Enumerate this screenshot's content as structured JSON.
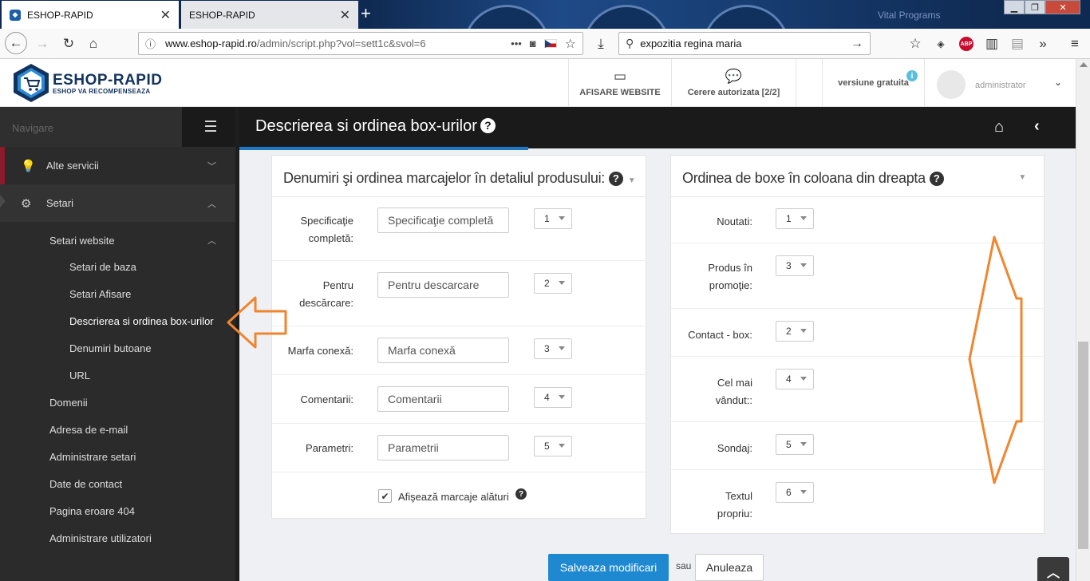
{
  "browser": {
    "tabs": [
      {
        "title": "ESHOP-RAPID",
        "active": true
      },
      {
        "title": "ESHOP-RAPID",
        "active": false
      }
    ],
    "url_domain": "www.eshop-rapid.ro",
    "url_path": "/admin/script.php?vol=sett1c&svol=6",
    "search_value": "expozitia regina maria",
    "bg_text": "Vital Programs",
    "menu_dots": "•••"
  },
  "header": {
    "logo_title": "ESHOP-RAPID",
    "logo_subtitle": "ESHOP VA RECOMPENSEAZA",
    "afisare_label": "AFISARE WEBSITE",
    "cerere_label": "Cerere autorizata [2/2]",
    "versiune_label": "versiune gratuita",
    "info_badge": "i",
    "user_name": "administrator"
  },
  "sidebar": {
    "nav_label": "Navigare",
    "alte_servicii": "Alte servicii",
    "setari": "Setari",
    "setari_website": "Setari website",
    "sub_items": [
      "Setari de baza",
      "Setari Afisare",
      "Descrierea si ordinea box-urilor",
      "Denumiri butoane",
      "URL"
    ],
    "items": [
      "Domenii",
      "Adresa de e-mail",
      "Administrare setari",
      "Date de contact",
      "Pagina eroare 404",
      "Administrare utilizatori"
    ]
  },
  "page": {
    "title": "Descrierea si ordinea box-urilor"
  },
  "left_panel": {
    "title": "Denumiri şi ordinea marcajelor în detaliul produsului:",
    "rows": [
      {
        "label_1": "Specificaţie",
        "label_2": "completă:",
        "value": "Specificaţie completă",
        "order": "1"
      },
      {
        "label_1": "Pentru",
        "label_2": "descărcare:",
        "value": "Pentru descarcare",
        "order": "2"
      },
      {
        "label_1": "Marfa conexă:",
        "label_2": "",
        "value": "Marfa conexă",
        "order": "3"
      },
      {
        "label_1": "Comentarii:",
        "label_2": "",
        "value": "Comentarii",
        "order": "4"
      },
      {
        "label_1": "Parametri:",
        "label_2": "",
        "value": "Parametrii",
        "order": "5"
      }
    ],
    "checkbox_label": "Afişează marcaje alături"
  },
  "right_panel": {
    "title": "Ordinea de boxe în coloana din dreapta",
    "rows": [
      {
        "label_1": "Noutati:",
        "label_2": "",
        "order": "1"
      },
      {
        "label_1": "Produs în",
        "label_2": "promoţie:",
        "order": "3"
      },
      {
        "label_1": "Contact - box:",
        "label_2": "",
        "order": "2"
      },
      {
        "label_1": "Cel mai",
        "label_2": "vândut::",
        "order": "4"
      },
      {
        "label_1": "Sondaj:",
        "label_2": "",
        "order": "5"
      },
      {
        "label_1": "Textul",
        "label_2": "propriu:",
        "order": "6"
      }
    ]
  },
  "actions": {
    "save": "Salveaza modificari",
    "or": "sau",
    "cancel": "Anuleaza"
  },
  "colors": {
    "accent": "#1e88d0",
    "annotation_arrow": "#f0852e",
    "sidebar_bg": "#2b2b2b",
    "title_bg": "#1a1a1a",
    "logo_blue": "#12335e"
  }
}
